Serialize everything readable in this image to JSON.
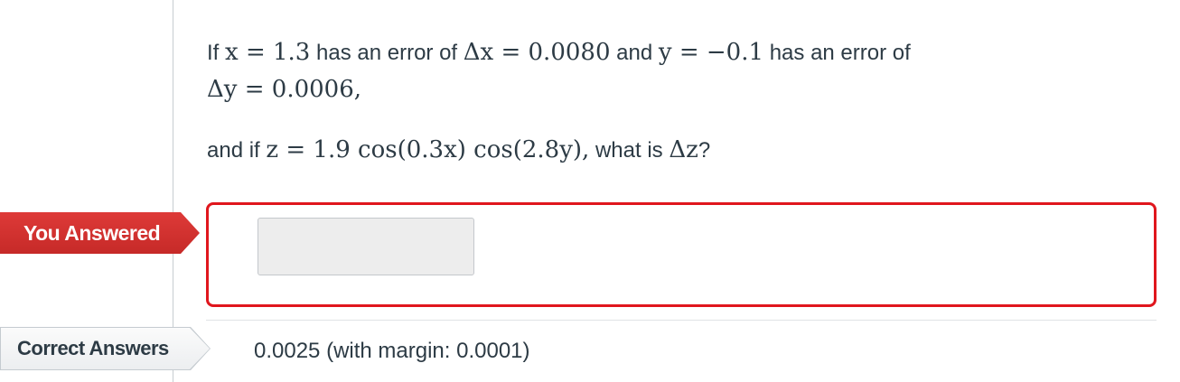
{
  "question": {
    "line1": {
      "t1": "If ",
      "m1": "x = 1.3",
      "t2": " has an error of ",
      "m2": "Δx = 0.0080",
      "t3": " and ",
      "m3": "y = −0.1",
      "t4": " has an error of"
    },
    "line2": {
      "m1": "Δy = 0.0006,"
    },
    "line3": {
      "t1": "and if ",
      "m1": "z = 1.9 cos(0.3x) cos(2.8y),",
      "t2": " what is ",
      "m2": "Δz",
      "t3": "?"
    }
  },
  "you_answered": {
    "label": "You Answered",
    "value": ""
  },
  "correct_answers": {
    "label": "Correct Answers",
    "value": "0.0025 (with margin: 0.0001)"
  },
  "colors": {
    "wrong_red": "#e0161d",
    "flag_red": "#d0312f",
    "text": "#2d3b45"
  }
}
